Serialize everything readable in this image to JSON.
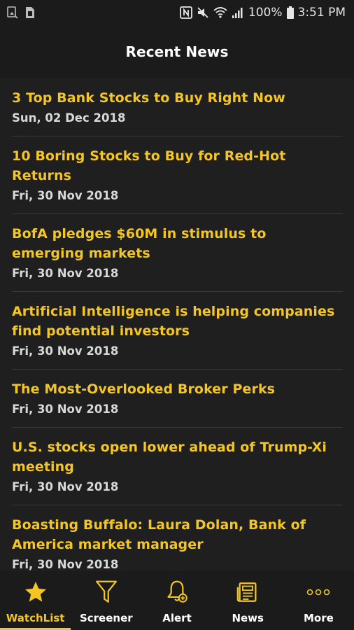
{
  "status_bar": {
    "battery_percent": "100%",
    "time": "3:51 PM",
    "icons": [
      "image-icon",
      "sim-icon",
      "nfc-icon",
      "mute-icon",
      "wifi-icon",
      "signal-icon",
      "battery-icon"
    ]
  },
  "header": {
    "title": "Recent News"
  },
  "news": [
    {
      "title": "3 Top Bank Stocks to Buy Right Now",
      "date": "Sun, 02 Dec 2018"
    },
    {
      "title": "10 Boring Stocks to Buy for Red-Hot Returns",
      "date": "Fri, 30 Nov 2018"
    },
    {
      "title": "BofA pledges $60M in stimulus to emerging markets",
      "date": "Fri, 30 Nov 2018"
    },
    {
      "title": "Artificial Intelligence is helping companies find potential investors",
      "date": "Fri, 30 Nov 2018"
    },
    {
      "title": "The Most-Overlooked Broker Perks",
      "date": "Fri, 30 Nov 2018"
    },
    {
      "title": "U.S. stocks open lower ahead of Trump-Xi meeting",
      "date": "Fri, 30 Nov 2018"
    },
    {
      "title": "Boasting Buffalo: Laura Dolan, Bank of America market manager",
      "date": "Fri, 30 Nov 2018"
    }
  ],
  "bottom_nav": {
    "items": [
      {
        "label": "WatchList",
        "icon": "star-icon",
        "active": true
      },
      {
        "label": "Screener",
        "icon": "filter-icon",
        "active": false
      },
      {
        "label": "Alert",
        "icon": "bell-plus-icon",
        "active": false
      },
      {
        "label": "News",
        "icon": "newspaper-icon",
        "active": false
      },
      {
        "label": "More",
        "icon": "more-dots-icon",
        "active": false
      }
    ]
  },
  "colors": {
    "accent": "#f3c623",
    "background": "#1f1f1f",
    "bar_background": "#1b1b1b",
    "date_text": "#d8d8d8",
    "divider": "#3a3a3a"
  }
}
